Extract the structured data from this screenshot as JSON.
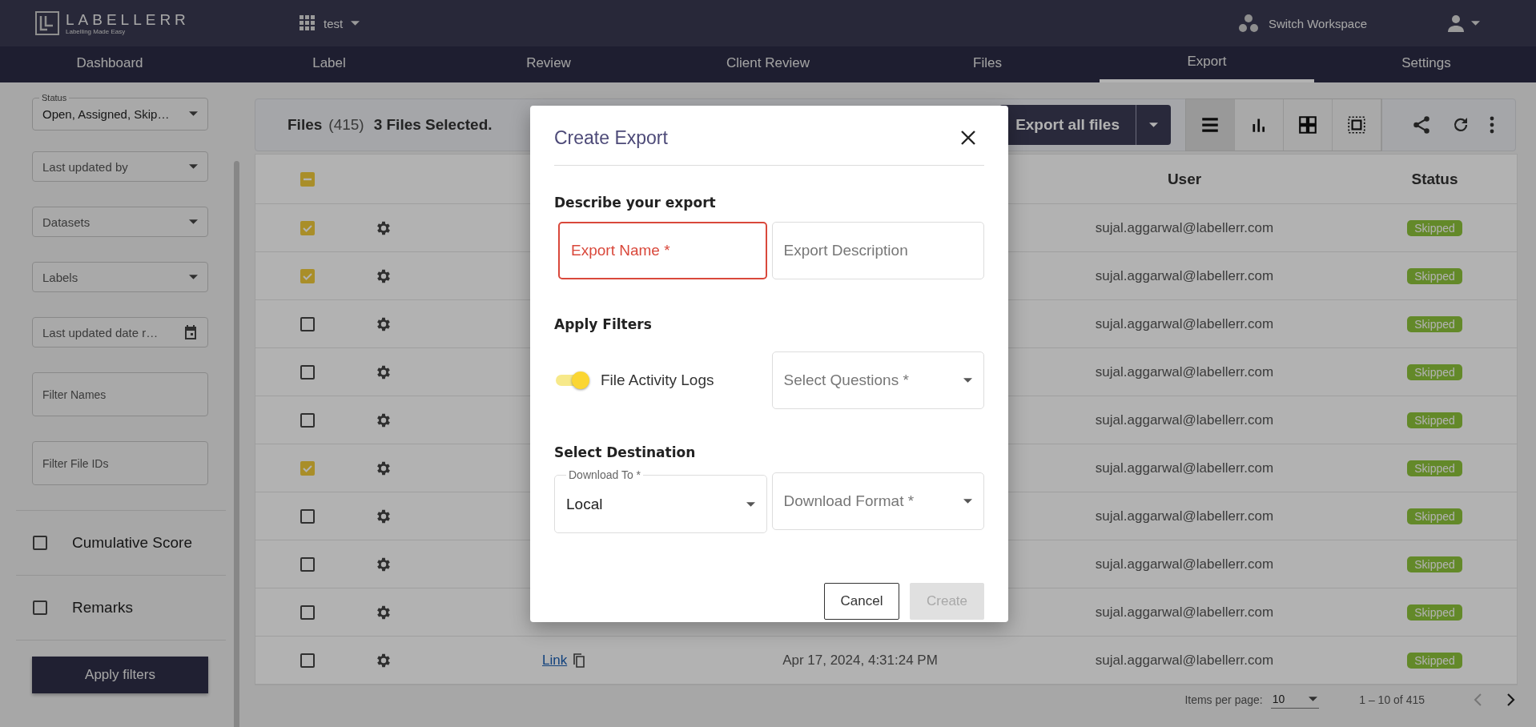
{
  "header": {
    "logo_title": "LABELLERR",
    "logo_tagline": "Labelling Made Easy",
    "project": "test",
    "workspace_button": "Switch Workspace"
  },
  "nav_tabs": [
    {
      "label": "Dashboard",
      "selected": false
    },
    {
      "label": "Label",
      "selected": false
    },
    {
      "label": "Review",
      "selected": false
    },
    {
      "label": "Client Review",
      "selected": false
    },
    {
      "label": "Files",
      "selected": false
    },
    {
      "label": "Export",
      "selected": true
    },
    {
      "label": "Settings",
      "selected": false
    }
  ],
  "sidebar": {
    "filters": [
      {
        "kind": "select",
        "label": "Status",
        "value": "Open, Assigned, Skip…"
      },
      {
        "kind": "select",
        "placeholder": "Last updated by"
      },
      {
        "kind": "select",
        "placeholder": "Datasets"
      },
      {
        "kind": "select",
        "placeholder": "Labels"
      },
      {
        "kind": "date",
        "placeholder": "Last updated date r…"
      },
      {
        "kind": "text",
        "placeholder": "Filter Names"
      },
      {
        "kind": "text",
        "placeholder": "Filter File IDs"
      }
    ],
    "options": [
      {
        "label": "Cumulative Score",
        "checked": false
      },
      {
        "label": "Remarks",
        "checked": false
      }
    ],
    "apply_button": "Apply filters"
  },
  "files_panel": {
    "title": "Files",
    "count": "(415)",
    "selection": "3 Files Selected.",
    "export_button": "Export all files",
    "view_buttons": [
      {
        "kind": "list",
        "selected": true
      },
      {
        "kind": "chart",
        "selected": false
      },
      {
        "kind": "grid",
        "selected": false
      },
      {
        "kind": "focus",
        "selected": false
      }
    ]
  },
  "table": {
    "header_checkbox": {
      "checked": true,
      "indeterminate": true
    },
    "columns": {
      "user": "User",
      "status": "Status"
    },
    "rows": [
      {
        "checked": true,
        "user": "sujal.aggarwal@labellerr.com",
        "status": "Skipped"
      },
      {
        "checked": true,
        "user": "sujal.aggarwal@labellerr.com",
        "status": "Skipped"
      },
      {
        "checked": false,
        "user": "sujal.aggarwal@labellerr.com",
        "status": "Skipped"
      },
      {
        "checked": false,
        "user": "sujal.aggarwal@labellerr.com",
        "status": "Skipped"
      },
      {
        "checked": false,
        "user": "sujal.aggarwal@labellerr.com",
        "status": "Skipped"
      },
      {
        "checked": true,
        "user": "sujal.aggarwal@labellerr.com",
        "status": "Skipped"
      },
      {
        "checked": false,
        "user": "sujal.aggarwal@labellerr.com",
        "status": "Skipped"
      },
      {
        "checked": false,
        "user": "sujal.aggarwal@labellerr.com",
        "status": "Skipped"
      },
      {
        "checked": false,
        "user": "sujal.aggarwal@labellerr.com",
        "status": "Skipped"
      },
      {
        "checked": false,
        "link": "Link",
        "date": "Apr 17, 2024, 4:31:24 PM",
        "user": "sujal.aggarwal@labellerr.com",
        "status": "Skipped"
      }
    ]
  },
  "pagination": {
    "label": "Items per page:",
    "page_size": "10",
    "range": "1 – 10 of 415"
  },
  "dialog": {
    "title": "Create Export",
    "sections": [
      {
        "heading": "Describe your export",
        "fields": [
          {
            "kind": "text",
            "placeholder": "Export Name *",
            "error": true
          },
          {
            "kind": "text",
            "placeholder": "Export Description",
            "error": false
          }
        ]
      },
      {
        "heading": "Apply Filters",
        "toggle": {
          "label": "File Activity Logs",
          "on": true
        },
        "fields": [
          {
            "kind": "select",
            "placeholder": "Select Questions *"
          }
        ]
      },
      {
        "heading": "Select Destination",
        "fields": [
          {
            "kind": "select",
            "label": "Download To *",
            "value": "Local"
          },
          {
            "kind": "select",
            "placeholder": "Download Format *"
          }
        ]
      }
    ],
    "cancel_button": "Cancel",
    "create_button": {
      "label": "Create",
      "disabled": true
    }
  }
}
